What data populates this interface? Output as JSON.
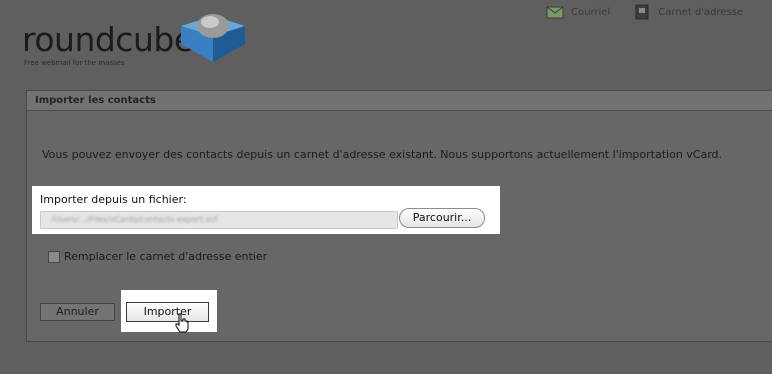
{
  "brand": {
    "name": "roundcube",
    "tagline": "Free webmail for the masses"
  },
  "nav": {
    "items": [
      {
        "label": "Courriel",
        "icon": "mail-icon"
      },
      {
        "label": "Carnet d'adresse",
        "icon": "address-book-icon"
      }
    ]
  },
  "panel": {
    "title": "Importer les contacts",
    "description": "Vous pouvez envoyer des contacts depuis un carnet d'adresse existant. Nous supportons actuellement l'importation vCard.",
    "file_label": "Importer depuis un fichier:",
    "file_path": "/Users/…/Files/vCards/contacts-export.vcf",
    "browse_label": "Parcourir...",
    "replace_label": "Remplacer le carnet d'adresse entier",
    "replace_checked": false,
    "cancel_label": "Annuler",
    "import_label": "Importer"
  },
  "colors": {
    "background": "#5f5f5f",
    "highlight": "#ffffff",
    "logo_blue": "#3a7fc4"
  }
}
